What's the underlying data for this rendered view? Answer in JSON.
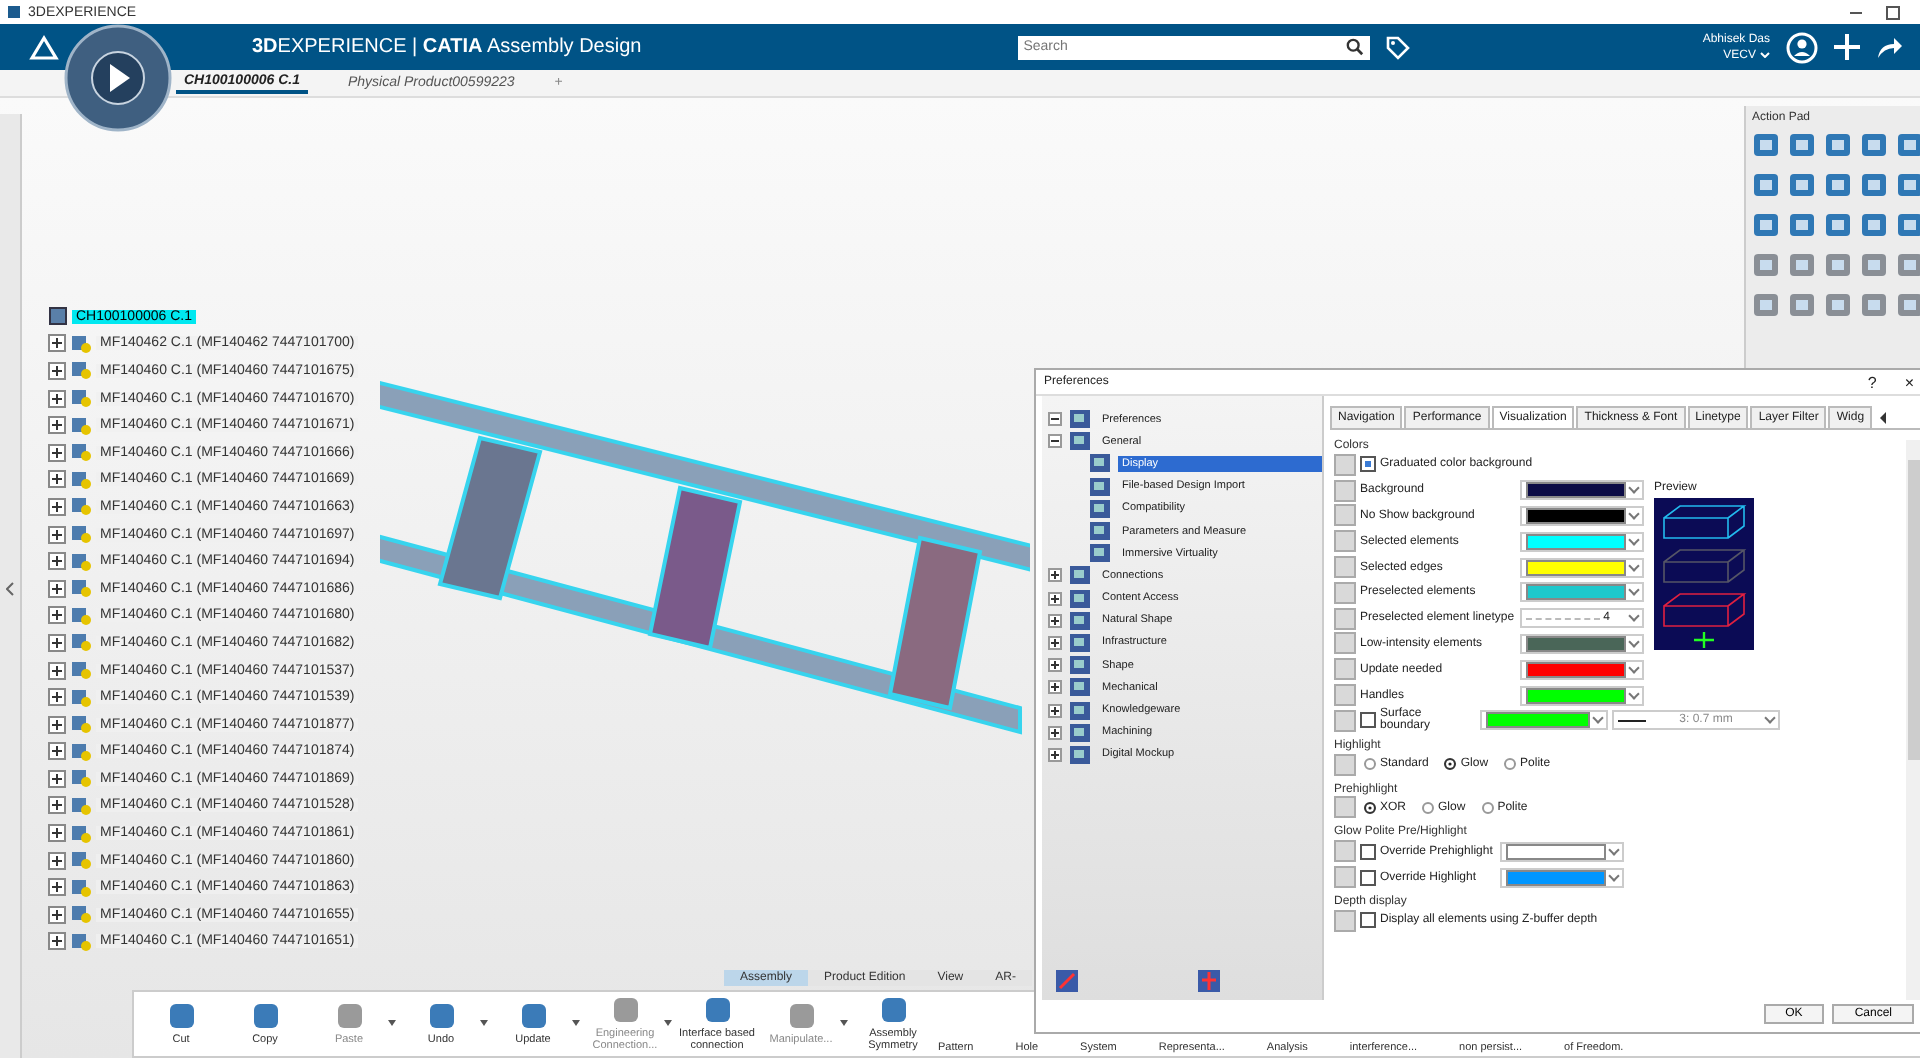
{
  "window": {
    "title": "3DEXPERIENCE"
  },
  "top_bar": {
    "app_title": "**3D**EXPERIENCE | **CATIA** Assembly Design",
    "search": {
      "placeholder": "Search"
    },
    "user": "Abhisek Das",
    "workspace": "VECV"
  },
  "doc_tabs": [
    {
      "label": "CH100100006 C.1",
      "selected": true
    },
    {
      "label": "Physical Product00599223",
      "selected": false
    }
  ],
  "new_tab": "+",
  "tree": {
    "root": {
      "label": "CH100100006 C.1",
      "selected": true
    },
    "rows": [
      {
        "label": "MF140462 C.1 (MF140462 7447101700)",
        "selected": false
      },
      {
        "label": "MF140460 C.1 (MF140460 7447101675)",
        "selected": false
      },
      {
        "label": "MF140460 C.1 (MF140460 7447101670)",
        "selected": false
      },
      {
        "label": "MF140460 C.1 (MF140460 7447101671)",
        "selected": false
      },
      {
        "label": "MF140460 C.1 (MF140460 7447101666)",
        "selected": false
      },
      {
        "label": "MF140460 C.1 (MF140460 7447101669)",
        "selected": false
      },
      {
        "label": "MF140460 C.1 (MF140460 7447101663)",
        "selected": false
      },
      {
        "label": "MF140460 C.1 (MF140460 7447101697)",
        "selected": false
      },
      {
        "label": "MF140460 C.1 (MF140460 7447101694)",
        "selected": false
      },
      {
        "label": "MF140460 C.1 (MF140460 7447101686)",
        "selected": false
      },
      {
        "label": "MF140460 C.1 (MF140460 7447101680)",
        "selected": false
      },
      {
        "label": "MF140460 C.1 (MF140460 7447101682)",
        "selected": false
      },
      {
        "label": "MF140460 C.1 (MF140460 7447101537)",
        "selected": false
      },
      {
        "label": "MF140460 C.1 (MF140460 7447101539)",
        "selected": false
      },
      {
        "label": "MF140460 C.1 (MF140460 7447101877)",
        "selected": false
      },
      {
        "label": "MF140460 C.1 (MF140460 7447101874)",
        "selected": false
      },
      {
        "label": "MF140460 C.1 (MF140460 7447101869)",
        "selected": false
      },
      {
        "label": "MF140460 C.1 (MF140460 7447101528)",
        "selected": false
      },
      {
        "label": "MF140460 C.1 (MF140460 7447101861)",
        "selected": false
      },
      {
        "label": "MF140460 C.1 (MF140460 7447101860)",
        "selected": false
      },
      {
        "label": "MF140460 C.1 (MF140460 7447101863)",
        "selected": false
      },
      {
        "label": "MF140460 C.1 (MF140460 7447101655)",
        "selected": false
      },
      {
        "label": "MF140460 C.1 (MF140460 7447101651)",
        "selected": false
      }
    ]
  },
  "action_pad": {
    "title": "Action Pad"
  },
  "toolbar_tabs": [
    {
      "label": "Assembly",
      "selected": true
    },
    {
      "label": "Product Edition",
      "selected": false
    },
    {
      "label": "View",
      "selected": false
    },
    {
      "label": "AR-",
      "selected": false
    }
  ],
  "toolbar": [
    {
      "label": "Cut",
      "disabled": false,
      "dropdown": false
    },
    {
      "label": "Copy",
      "disabled": false,
      "dropdown": false
    },
    {
      "label": "Paste",
      "disabled": true,
      "dropdown": true
    },
    {
      "label": "Undo",
      "disabled": false,
      "dropdown": true
    },
    {
      "label": "Update",
      "disabled": false,
      "dropdown": true
    },
    {
      "label": "Engineering Connection...",
      "disabled": true,
      "dropdown": true
    },
    {
      "label": "Interface based connection",
      "disabled": false,
      "dropdown": false
    },
    {
      "label": "Manipulate...",
      "disabled": true,
      "dropdown": true
    },
    {
      "label": "Assembly Symmetry",
      "disabled": false,
      "dropdown": false
    }
  ],
  "toolbar_covered": [
    "Pattern",
    "Hole",
    "System",
    "Representa...",
    "Analysis",
    "interference...",
    "non persist...",
    "of Freedom."
  ],
  "dialog": {
    "title": "Preferences",
    "help": "?",
    "close": "×",
    "tree": [
      {
        "label": "Preferences",
        "expanded": true,
        "children": [
          {
            "label": "General",
            "expanded": true,
            "children": [
              {
                "label": "Display",
                "selected": true
              },
              {
                "label": "File-based Design Import",
                "selected": false
              },
              {
                "label": "Compatibility",
                "selected": false
              },
              {
                "label": "Parameters and Measure",
                "selected": false
              },
              {
                "label": "Immersive Virtuality",
                "selected": false
              }
            ]
          },
          {
            "label": "Connections",
            "expanded": false
          },
          {
            "label": "Content Access",
            "expanded": false
          },
          {
            "label": "Natural Shape",
            "expanded": false
          },
          {
            "label": "Infrastructure",
            "expanded": false
          },
          {
            "label": "Shape",
            "expanded": false
          },
          {
            "label": "Mechanical",
            "expanded": false
          },
          {
            "label": "Knowledgeware",
            "expanded": false
          },
          {
            "label": "Machining",
            "expanded": false
          },
          {
            "label": "Digital Mockup",
            "expanded": false
          }
        ]
      }
    ],
    "tabs": [
      {
        "label": "Navigation",
        "selected": false
      },
      {
        "label": "Performance",
        "selected": false
      },
      {
        "label": "Visualization",
        "selected": true
      },
      {
        "label": "Thickness & Font",
        "selected": false
      },
      {
        "label": "Linetype",
        "selected": false
      },
      {
        "label": "Layer Filter",
        "selected": false
      },
      {
        "label": "Widg",
        "selected": false
      }
    ],
    "colors": {
      "title": "Colors",
      "graduated": {
        "label": "Graduated color background",
        "checked": true
      },
      "rows": [
        {
          "kind": "color",
          "label": "Background",
          "color": "#0b0b45"
        },
        {
          "kind": "color",
          "label": "No Show background",
          "color": "#000000"
        },
        {
          "kind": "color",
          "label": "Selected elements",
          "color": "#00ffff"
        },
        {
          "kind": "color",
          "label": "Selected edges",
          "color": "#ffff00"
        },
        {
          "kind": "color",
          "label": "Preselected elements",
          "color": "#1ec8cc"
        },
        {
          "kind": "linetype",
          "label": "Preselected element linetype",
          "value": "4"
        },
        {
          "kind": "color",
          "label": "Low-intensity elements",
          "color": "#4a6658"
        },
        {
          "kind": "color",
          "label": "Update needed",
          "color": "#ff0000"
        },
        {
          "kind": "color",
          "label": "Handles",
          "color": "#00ff00"
        }
      ],
      "preview": "Preview",
      "surface": {
        "label": "Surface boundary",
        "checked": false,
        "color": "#00ff00",
        "thickness": "3: 0.7 mm"
      }
    },
    "highlight": {
      "title": "Highlight",
      "options": [
        {
          "label": "Standard",
          "selected": false
        },
        {
          "label": "Glow",
          "selected": true
        },
        {
          "label": "Polite",
          "selected": false
        }
      ]
    },
    "prehighlight": {
      "title": "Prehighlight",
      "options": [
        {
          "label": "XOR",
          "selected": true
        },
        {
          "label": "Glow",
          "selected": false
        },
        {
          "label": "Polite",
          "selected": false
        }
      ]
    },
    "glow": {
      "title": "Glow Polite Pre/Highlight",
      "rows": [
        {
          "label": "Override Prehighlight",
          "checked": false,
          "color": "#ffffff"
        },
        {
          "label": "Override Highlight",
          "checked": false,
          "color": "#0096ff"
        }
      ]
    },
    "depth": {
      "title": "Depth display",
      "option": {
        "label": "Display all elements using Z-buffer depth",
        "checked": false
      }
    },
    "buttons": [
      "OK",
      "Cancel"
    ]
  }
}
